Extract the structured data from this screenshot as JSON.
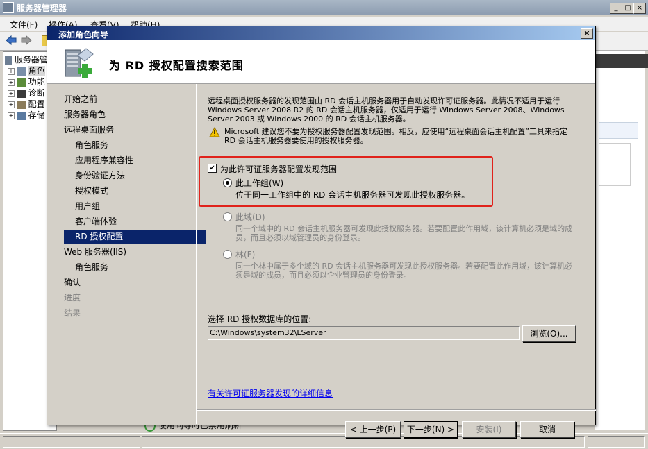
{
  "app": {
    "title": "服务器管理器",
    "menu": [
      "文件(F)",
      "操作(A)",
      "查看(V)",
      "帮助(H)"
    ],
    "tree": [
      {
        "label": "服务器管"
      },
      {
        "label": "角色"
      },
      {
        "label": "功能"
      },
      {
        "label": "诊断"
      },
      {
        "label": "配置"
      },
      {
        "label": "存储"
      }
    ],
    "behind_text": "使用向导时已禁用刷新"
  },
  "dialog": {
    "title": "添加角色向导",
    "header_title": "为 RD 授权配置搜索范围",
    "nav": [
      {
        "label": "开始之前",
        "state": "normal"
      },
      {
        "label": "服务器角色",
        "state": "normal"
      },
      {
        "label": "远程桌面服务",
        "state": "normal"
      },
      {
        "label": "角色服务",
        "state": "sub"
      },
      {
        "label": "应用程序兼容性",
        "state": "sub"
      },
      {
        "label": "身份验证方法",
        "state": "sub"
      },
      {
        "label": "授权模式",
        "state": "sub"
      },
      {
        "label": "用户组",
        "state": "sub"
      },
      {
        "label": "客户端体验",
        "state": "sub"
      },
      {
        "label": "RD 授权配置",
        "state": "selected"
      },
      {
        "label": "Web 服务器(IIS)",
        "state": "normal"
      },
      {
        "label": "角色服务",
        "state": "sub"
      },
      {
        "label": "确认",
        "state": "normal"
      },
      {
        "label": "进度",
        "state": "disabled"
      },
      {
        "label": "结果",
        "state": "disabled"
      }
    ],
    "description": "远程桌面授权服务器的发现范围由 RD 会话主机服务器用于自动发现许可证服务器。此情况不适用于运行 Windows Server 2008 R2 的 RD 会话主机服务器，仅适用于运行 Windows Server 2008、Windows Server 2003 或 Windows 2000 的 RD 会话主机服务器。",
    "warning": "Microsoft 建议您不要为授权服务器配置发现范围。相反，应使用“远程桌面会话主机配置”工具来指定 RD 会话主机服务器要使用的授权服务器。",
    "checkbox_label": "为此许可证服务器配置发现范围",
    "checkbox_checked": true,
    "options": [
      {
        "label": "此工作组(W)",
        "desc": "位于同一工作组中的 RD 会话主机服务器可发现此授权服务器。",
        "selected": true,
        "enabled": true
      },
      {
        "label": "此域(D)",
        "desc": "同一个域中的 RD 会话主机服务器可发现此授权服务器。若要配置此作用域，该计算机必须是域的成员，而且必须以域管理员的身份登录。",
        "selected": false,
        "enabled": false
      },
      {
        "label": "林(F)",
        "desc": "同一个林中属于多个域的 RD 会话主机服务器可发现此授权服务器。若要配置此作用域，该计算机必须是域的成员，而且必须以企业管理员的身份登录。",
        "selected": false,
        "enabled": false
      }
    ],
    "db_label": "选择 RD 授权数据库的位置:",
    "db_path": "C:\\Windows\\system32\\LServer",
    "browse_button": "浏览(O)...",
    "detail_link": "有关许可证服务器发现的详细信息",
    "buttons": {
      "back": "< 上一步(P)",
      "next": "下一步(N) >",
      "install": "安装(I)",
      "cancel": "取消"
    },
    "highlight_color": "#e0221b"
  }
}
